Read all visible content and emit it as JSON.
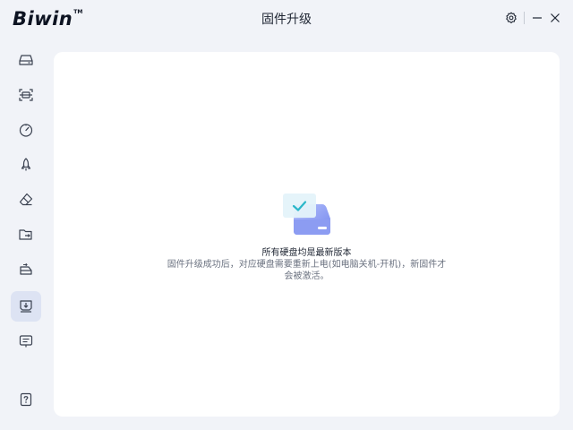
{
  "app": {
    "brand": "Biwin",
    "trademark": "TM",
    "title": "固件升级"
  },
  "window_controls": [
    {
      "name": "settings-button",
      "icon": "gear-icon"
    },
    {
      "name": "minimize-button",
      "icon": "minimize-icon"
    },
    {
      "name": "close-button",
      "icon": "close-icon"
    }
  ],
  "sidebar": {
    "items": [
      {
        "name": "drive-overview",
        "icon": "hard-drive-icon",
        "active": false
      },
      {
        "name": "scan",
        "icon": "scan-icon",
        "active": false
      },
      {
        "name": "speed-test",
        "icon": "speedometer-icon",
        "active": false
      },
      {
        "name": "boost",
        "icon": "rocket-icon",
        "active": false
      },
      {
        "name": "secure-erase",
        "icon": "eraser-icon",
        "active": false
      },
      {
        "name": "data-migration",
        "icon": "folder-transfer-icon",
        "active": false
      },
      {
        "name": "drive-clone",
        "icon": "drive-arrow-icon",
        "active": false
      },
      {
        "name": "firmware-upgrade",
        "icon": "firmware-icon",
        "active": true
      },
      {
        "name": "messages",
        "icon": "message-icon",
        "active": false
      },
      {
        "name": "help",
        "icon": "help-icon",
        "active": false
      }
    ]
  },
  "main": {
    "status_icon": "drive-check-icon",
    "status_title": "所有硬盘均是最新版本",
    "status_description": "固件升级成功后，对应硬盘需要重新上电(如电脑关机-开机)，新固件才会被激活。"
  },
  "colors": {
    "background": "#f1f3f8",
    "panel": "#ffffff",
    "active_nav": "#dde3f3",
    "accent": "#7d8ff0",
    "check": "#2ab7c9"
  }
}
